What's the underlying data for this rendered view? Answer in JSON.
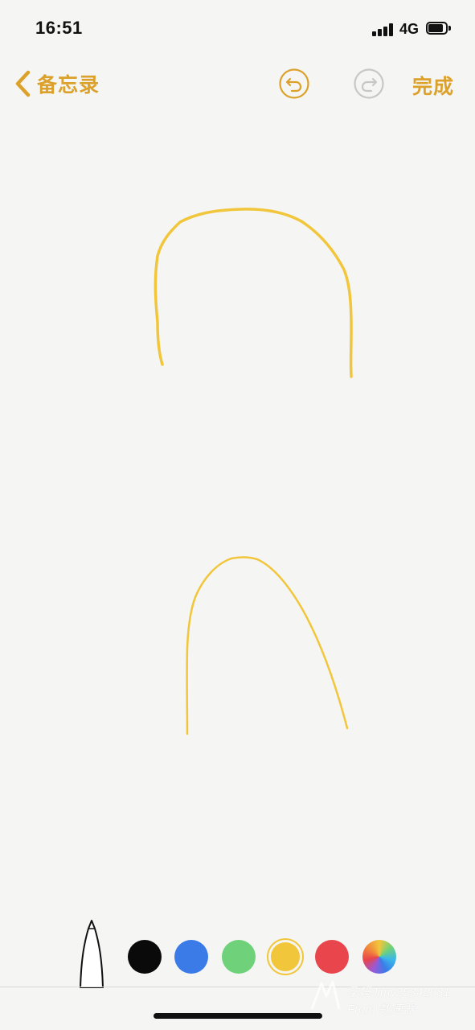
{
  "status_bar": {
    "time": "16:51",
    "network": "4G",
    "signal_icon": "cellular-signal-icon",
    "battery_icon": "battery-icon"
  },
  "nav": {
    "back_label": "备忘录",
    "back_icon": "chevron-left-icon",
    "undo_icon": "undo-icon",
    "redo_icon": "redo-icon",
    "done_label": "完成"
  },
  "colors": {
    "accent": "#dca12a",
    "ink": "#f2c63b"
  },
  "palette": {
    "tool": "pen-tool",
    "swatches": [
      {
        "name": "black",
        "color": "#0a0a0a",
        "selected": false
      },
      {
        "name": "blue",
        "color": "#3a7be8",
        "selected": false
      },
      {
        "name": "green",
        "color": "#6fd27a",
        "selected": false
      },
      {
        "name": "yellow",
        "color": "#f2c63b",
        "selected": true
      },
      {
        "name": "red",
        "color": "#e8454c",
        "selected": false
      },
      {
        "name": "multicolor",
        "color": "rainbow",
        "selected": false
      }
    ]
  },
  "watermark": {
    "line1": "孕妈Jimy25342081",
    "line2": "From 数速器"
  }
}
